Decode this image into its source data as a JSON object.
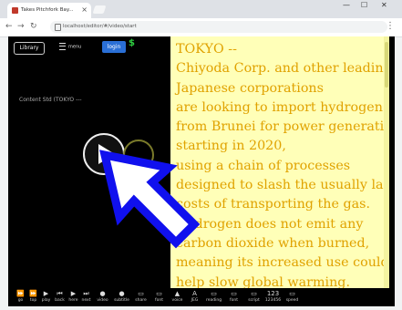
{
  "browser": {
    "tab_title": "Takes Pitchfork Bay...",
    "tab_close": "×",
    "url": "localhost/editor/#/video/start",
    "minimize": "—",
    "maximize": "☐",
    "close": "✕"
  },
  "app": {
    "library_label": "Library",
    "menu_label": "menu",
    "login_label": "login",
    "dollar": "$",
    "content_label": "Content Std (TOKYO ---",
    "text_lines": [
      "TOKYO --",
      "Chiyoda Corp. and other leading",
      "Japanese corporations",
      "are looking to import hydrogen",
      "from Brunei for power generation",
      "starting in 2020,",
      "using a chain of processes",
      "designed to slash the usually large",
      "costs of transporting the gas.",
      "Hydrogen does not emit any",
      "carbon dioxide when burned,",
      "meaning its increased use could",
      "help slow global warming."
    ],
    "toolbar": [
      {
        "icon": "⏩",
        "label": "go"
      },
      {
        "icon": "⏩",
        "label": "top"
      },
      {
        "icon": "▶",
        "label": "play"
      },
      {
        "icon": "⏮",
        "label": "back"
      },
      {
        "icon": "▶",
        "label": "here"
      },
      {
        "icon": "⏭",
        "label": "next"
      },
      {
        "icon": "●",
        "label": "video"
      },
      {
        "icon": "●",
        "label": "subtitle"
      },
      {
        "icon": "▭",
        "label": "share"
      },
      {
        "icon": "▭",
        "label": "font"
      },
      {
        "icon": "▲",
        "label": "voice"
      },
      {
        "icon": "A",
        "label": "JEG"
      },
      {
        "icon": "▭",
        "label": "reading"
      },
      {
        "icon": "▭",
        "label": "font"
      },
      {
        "icon": "▭",
        "label": "script"
      },
      {
        "icon": "123",
        "label": "123456"
      },
      {
        "icon": "▭",
        "label": "speed"
      }
    ]
  }
}
